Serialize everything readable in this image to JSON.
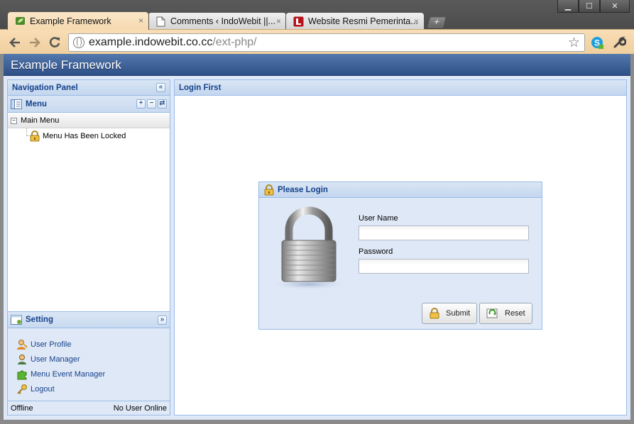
{
  "browser": {
    "window_controls": {
      "minimize": "▁",
      "maximize": "☐",
      "close": "✕"
    },
    "tabs": [
      {
        "title": "Example Framework",
        "active": true,
        "icon": "leaf-favicon-icon"
      },
      {
        "title": "Comments ‹ IndoWebit ||...",
        "active": false,
        "icon": "page-icon"
      },
      {
        "title": "Website Resmi Pemerinta...",
        "active": false,
        "icon": "red-bookmark-icon"
      }
    ],
    "tab_close": "×",
    "new_tab": "+",
    "url": {
      "host": "example.indowebit.co.cc",
      "path": "/ext-php/"
    }
  },
  "app": {
    "title": "Example Framework",
    "nav_panel": {
      "title": "Navigation Panel",
      "menu_title": "Menu",
      "tree_root": "Main Menu",
      "tree_child": "Menu Has Been Locked"
    },
    "setting": {
      "title": "Setting",
      "items": [
        {
          "label": "User Profile",
          "icon": "user-profile-icon"
        },
        {
          "label": "User Manager",
          "icon": "user-manager-icon"
        },
        {
          "label": "Menu Event Manager",
          "icon": "puzzle-icon"
        },
        {
          "label": "Logout",
          "icon": "key-icon"
        }
      ]
    },
    "status": {
      "left": "Offline",
      "right": "No User Online"
    },
    "main_panel": {
      "title": "Login First"
    },
    "login": {
      "title": "Please Login",
      "username_label": "User Name",
      "username_value": "",
      "password_label": "Password",
      "password_value": "",
      "submit_label": "Submit",
      "reset_label": "Reset"
    }
  },
  "colors": {
    "panel_title": "#15428b",
    "header": "#2e5088",
    "panel_border": "#99bbe8"
  }
}
